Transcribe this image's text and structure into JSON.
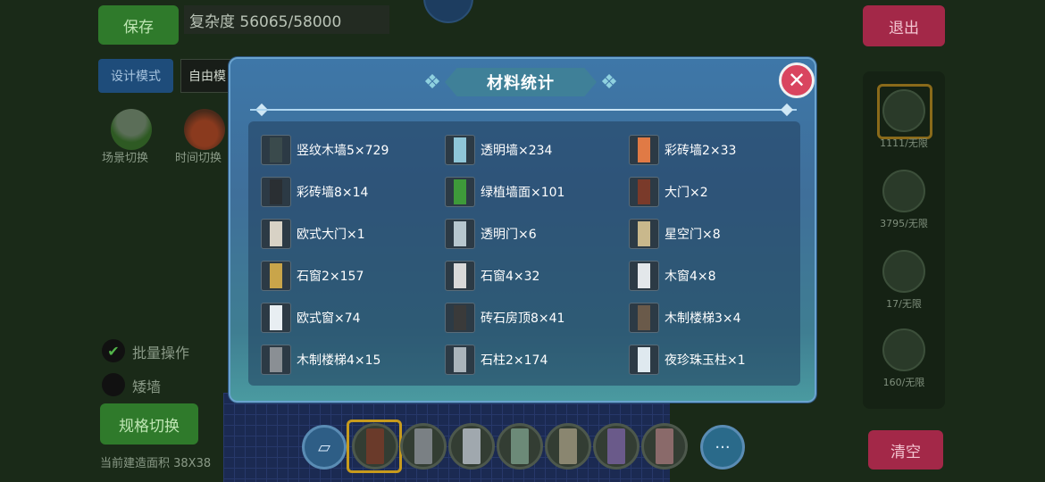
{
  "hud": {
    "save_label": "保存",
    "complexity_text": "复杂度 56065/58000",
    "exit_label": "退出",
    "design_mode_label": "设计模式",
    "free_mode_label": "自由模",
    "scene_switch_label": "场景切换",
    "time_switch_label": "时间切换",
    "batch_label": "批量操作",
    "low_wall_label": "矮墙",
    "spec_switch_label": "规格切换",
    "area_text": "当前建造面积 38X38",
    "clear_label": "清空",
    "right_panel": [
      {
        "label": "1111/无限",
        "icon": "wall-block-icon"
      },
      {
        "label": "3795/无限",
        "icon": "brick-icon"
      },
      {
        "label": "17/无限",
        "icon": "door-icon"
      },
      {
        "label": "160/无限",
        "icon": "frame-icon"
      }
    ],
    "more_label": "···"
  },
  "modal": {
    "title": "材料统计",
    "close_icon": "close-icon",
    "items": [
      {
        "label": "竖纹木墙5×729",
        "icon": "wood-wall-icon",
        "color": "#3a4a4c"
      },
      {
        "label": "透明墙×234",
        "icon": "glass-wall-icon",
        "color": "#8fc6d8"
      },
      {
        "label": "彩砖墙2×33",
        "icon": "color-brick-icon",
        "color": "#e07a45"
      },
      {
        "label": "彩砖墙8×14",
        "icon": "dark-brick-icon",
        "color": "#2a2f33"
      },
      {
        "label": "绿植墙面×101",
        "icon": "green-wall-icon",
        "color": "#3e9a3a"
      },
      {
        "label": "大门×2",
        "icon": "big-door-icon",
        "color": "#7a3a2a"
      },
      {
        "label": "欧式大门×1",
        "icon": "euro-gate-icon",
        "color": "#d8d2c5"
      },
      {
        "label": "透明门×6",
        "icon": "glass-door-icon",
        "color": "#b7c7cf"
      },
      {
        "label": "星空门×8",
        "icon": "star-door-icon",
        "color": "#c9b88c"
      },
      {
        "label": "石窗2×157",
        "icon": "stone-window-icon",
        "color": "#c9a54a"
      },
      {
        "label": "石窗4×32",
        "icon": "stone-window-2-icon",
        "color": "#d9d9d9"
      },
      {
        "label": "木窗4×8",
        "icon": "wood-window-icon",
        "color": "#e3e7ea"
      },
      {
        "label": "欧式窗×74",
        "icon": "euro-window-icon",
        "color": "#e8eef2"
      },
      {
        "label": "砖石房顶8×41",
        "icon": "roof-icon",
        "color": "#3a3a3a"
      },
      {
        "label": "木制楼梯3×4",
        "icon": "wood-stairs-icon",
        "color": "#6a5a4a"
      },
      {
        "label": "木制楼梯4×15",
        "icon": "wood-stairs-2-icon",
        "color": "#8a8f94"
      },
      {
        "label": "石柱2×174",
        "icon": "stone-pillar-icon",
        "color": "#aab4bb"
      },
      {
        "label": "夜珍珠玉柱×1",
        "icon": "pearl-pillar-icon",
        "color": "#dfe9ef"
      }
    ]
  }
}
